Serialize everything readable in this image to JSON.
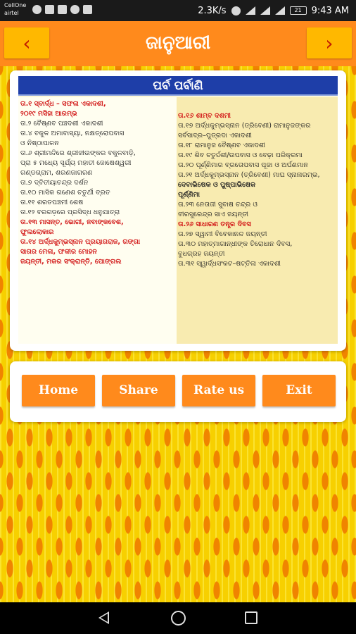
{
  "status_bar": {
    "carrier_1": "CellOne",
    "carrier_2": "airtel",
    "speed": "2.3K/s",
    "battery": "21",
    "time": "9:43 AM"
  },
  "header": {
    "title": "ଜାନୁଆରୀ",
    "prev_label": "‹",
    "next_label": "›"
  },
  "calendar": {
    "heading": "ପର୍ବ ପର୍ବାଣି",
    "left_entries": [
      {
        "text": "ତା.୧  ସ୍ବାର୍ଦ୍ଧ – ସଫଳା ଏକାଦଶୀ,",
        "style": "red"
      },
      {
        "text": "        ୨୦୧୯ ମସିହା ଆରମ୍ଭ",
        "style": "red"
      },
      {
        "text": "ତା.୨  ବୈଷ୍ଣବ ପଞ୍ଚଦଶୀ ଏକାଦଶୀ",
        "style": "normal"
      },
      {
        "text": "ତା.୪  ବକୁଳ ଅମାବାସ୍ୟା, ନକ୍ଷତ୍ରୋପବାସ",
        "style": "normal"
      },
      {
        "text": "        ଓ ନିଷ୍ଠାପାଳନ",
        "style": "normal"
      },
      {
        "text": "ତା.୬  ଶ୍ରୀମନ୍ଦିରେ ଶ୍ରୀଜୀଉଙ୍କର ବକୁଳବାଡ଼ି,",
        "style": "normal"
      },
      {
        "text": "        ପ୍ରା ୫ ମଧ୍ୟେ ସୂର୍ଯ୍ୟ ମହାତୀ ଜୋଷେଶ୍ୱରୀ",
        "style": "normal"
      },
      {
        "text": "        ଗଣ୍ଡଗ୍ରାମ, ଶରଣଜାଗରଣ",
        "style": "normal"
      },
      {
        "text": "ତା.୭  ଦ୍ବିତୀୟାଚନ୍ଦ୍ର ଦର୍ଶନ",
        "style": "normal"
      },
      {
        "text": "ତା.୧୦  ମାସିକ ଗଣେଶ ଚତୁର୍ଥୀ ବ୍ରତ",
        "style": "normal"
      },
      {
        "text": "ତା.୧୧  ଶରତପଞ୍ଚମୀ ଶେଷ",
        "style": "normal"
      },
      {
        "text": "ତା.୧୨  ବରଗଡ଼ରେ ପ୍ରସିଦ୍ଧ ଧନୁଯାତ୍ରା",
        "style": "normal"
      },
      {
        "text": "ତା.୧୩  ମାସନ୍ତ, ଭୋଗୀ, ନବାଙ୍କବେଶ,",
        "style": "red"
      },
      {
        "text": "        ଫୁଲଲୋକାର",
        "style": "red"
      },
      {
        "text": "ତା.୧୪  ଅର୍ଦ୍ଧକୁମ୍ଭସ୍ନାନ ପ୍ରୟାଗରାଜ, ଗଙ୍ଗା",
        "style": "red"
      },
      {
        "text": "        ସାଗର ମେଳା, ଫକୀର ମୋହନ",
        "style": "red"
      },
      {
        "text": "        ଜୟନ୍ତୀ, ମକର ସଂକ୍ରାନ୍ତି, ପୋଙ୍ଗଲ",
        "style": "red"
      }
    ],
    "right_entries": [
      {
        "text": "ତା.୧୬  ଶାମ୍ବ ଦଶମୀ",
        "style": "red"
      },
      {
        "text": "ତା.୧୭  ଅର୍ଦ୍ଧକୁମ୍ଭସ୍ନାନ (ତ୍ରିବେଣୀ) ରାମାନୁଜଙ୍କର",
        "style": "normal"
      },
      {
        "text": "        ସର୍ବସାଦ୍ର–ପୁତ୍ରଦା ଏକାଦଶୀ",
        "style": "normal"
      },
      {
        "text": "ତା.୧୮  ରାମାନୁଜ ବୈଷ୍ଣବ ଏକାଦଶୀ",
        "style": "normal"
      },
      {
        "text": "ତା.୧୯  ଶିବ ଚତୁର୍ଦ୍ଦଶୀ/ଉପବାସ ଓ ବେଢ଼ା ପରିକ୍ରମା",
        "style": "normal"
      },
      {
        "text": "ତା.୨୦  ପୂର୍ଣ୍ଣିମାର ବ୍ରତୋପବାସ ପୂଜା ଓ ଅର୍ପଣମାନ",
        "style": "normal"
      },
      {
        "text": "ତା.୨୧  ଅର୍ଦ୍ଧକୁମ୍ଭସ୍ନାନ (ତ୍ରିବେଣୀ) ମାଘ ସ୍ନାନାରମ୍ଭ,",
        "style": "normal"
      },
      {
        "text": "        ଦେବାଭିଷେକ ଓ ପୁଷ୍ପାଭିଷେକ",
        "style": "bold"
      },
      {
        "text": "        ପୂର୍ଣ୍ଣିମା",
        "style": "bold"
      },
      {
        "text": "ତା.୨୩  ନେତାଜୀ ସୁବାଷ ଚନ୍ଦ୍ର ଓ",
        "style": "normal"
      },
      {
        "text": "        ବୀରସୁରେନ୍ଦ୍ର ସାଏ ଜୟନ୍ତୀ",
        "style": "normal"
      },
      {
        "text": "ତା.୨୬  ସାଧାରଣ ତନ୍ତ୍ର ଦିବସ",
        "style": "red"
      },
      {
        "text": "ତା.୨୭  ସ୍ୱାମୀ ବିବେକାନନ୍ଦ ଜୟନ୍ତୀ",
        "style": "normal"
      },
      {
        "text": "ତା.୩୦  ମହାତ୍ମାଗାନ୍ଧୀଙ୍କ ତିରୋଧାନ ଦିବସ,",
        "style": "normal"
      },
      {
        "text": "        ବୁଧଗ୍ରହ ଜୟନ୍ତୀ",
        "style": "normal"
      },
      {
        "text": "ତା.୩୧  ସ୍ୱାର୍ଦ୍ଧସଂକଟ–ଷଟ୍ତିଳା ଏକାଦଶୀ",
        "style": "normal"
      }
    ]
  },
  "actions": {
    "home": "Home",
    "share": "Share",
    "rate": "Rate us",
    "exit": "Exit"
  },
  "colors": {
    "header_bg": "#ff8a1c",
    "nav_button_bg": "#ffb800",
    "action_button_bg": "#ff8a1c",
    "page_bg": "#f4d200",
    "calendar_heading_bg": "#1e3ea8",
    "entry_red": "#d21818"
  }
}
